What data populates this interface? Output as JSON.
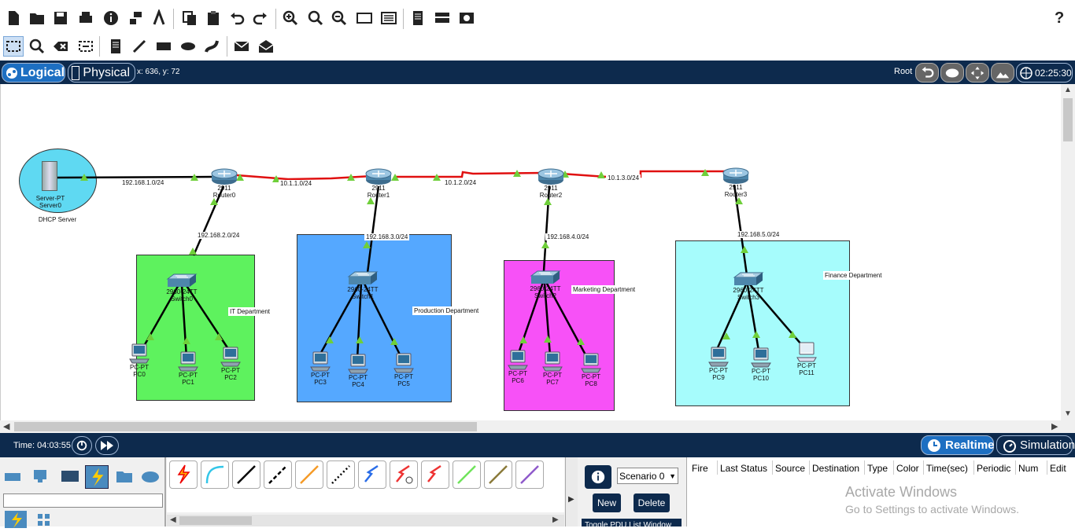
{
  "help_label": "?",
  "nav": {
    "logical_label": "Logical",
    "physical_label": "Physical",
    "coords": "x: 636, y: 72",
    "root_label": "Root",
    "clock": "02:25:30"
  },
  "networks": {
    "n1": "192.168.1.0/24",
    "n2": "10.1.1.0/24",
    "n3": "10.1.2.0/24",
    "n4": "10.1.3.0/24",
    "n5": "192.168.2.0/24",
    "n6": "192.168.3.0/24",
    "n7": "192.168.4.0/24",
    "n8": "192.168.5.0/24"
  },
  "server": {
    "type": "Server-PT",
    "name": "Server0",
    "caption": "DHCP Server"
  },
  "routers": [
    {
      "model": "2911",
      "name": "Router0"
    },
    {
      "model": "2911",
      "name": "Router1"
    },
    {
      "model": "2911",
      "name": "Router2"
    },
    {
      "model": "2911",
      "name": "Router3"
    }
  ],
  "switches": [
    {
      "model": "2960-24TT",
      "name": "Switch0"
    },
    {
      "model": "2960-24TT",
      "name": "Switch1"
    },
    {
      "model": "2960-24TT",
      "name": "Switch2"
    },
    {
      "model": "2960-24TT",
      "name": "Switch3"
    }
  ],
  "departments": {
    "it": "IT Department",
    "production": "Production Department",
    "marketing": "Marketing Department",
    "finance": "Finance Department"
  },
  "pcs": [
    {
      "type": "PC-PT",
      "name": "PC0"
    },
    {
      "type": "PC-PT",
      "name": "PC1"
    },
    {
      "type": "PC-PT",
      "name": "PC2"
    },
    {
      "type": "PC-PT",
      "name": "PC3"
    },
    {
      "type": "PC-PT",
      "name": "PC4"
    },
    {
      "type": "PC-PT",
      "name": "PC5"
    },
    {
      "type": "PC-PT",
      "name": "PC6"
    },
    {
      "type": "PC-PT",
      "name": "PC7"
    },
    {
      "type": "PC-PT",
      "name": "PC8"
    },
    {
      "type": "PC-PT",
      "name": "PC9"
    },
    {
      "type": "PC-PT",
      "name": "PC10"
    },
    {
      "type": "PC-PT",
      "name": "PC11"
    }
  ],
  "bottom": {
    "time": "Time: 04:03:55",
    "realtime_label": "Realtime",
    "simulation_label": "Simulation",
    "scenario": "Scenario 0",
    "new_label": "New",
    "delete_label": "Delete",
    "pdu_label": "Toggle PDU List Window",
    "columns": [
      "Fire",
      "Last Status",
      "Source",
      "Destination",
      "Type",
      "Color",
      "Time(sec)",
      "Periodic",
      "Num",
      "Edit"
    ],
    "watermark_title": "Activate Windows",
    "watermark_sub": "Go to Settings to activate Windows."
  },
  "colors": {
    "it": "#5ef25e",
    "production": "#55a8ff",
    "marketing": "#f751f7",
    "finance": "#a6fcfc",
    "serial_link": "#e01010",
    "nav_bg": "#0d2a4d"
  }
}
